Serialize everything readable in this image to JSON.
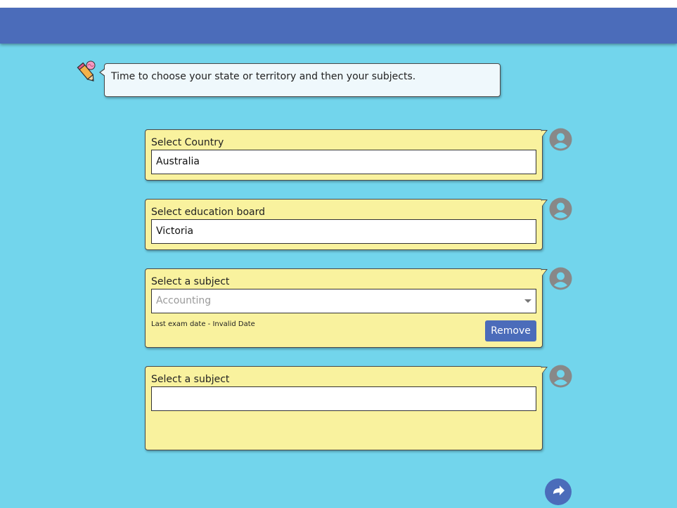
{
  "bot": {
    "avatar_icon": "pencil-brain-icon",
    "message": "Time to choose your state or territory and then your subjects."
  },
  "form": {
    "country": {
      "label": "Select Country",
      "value": "Australia"
    },
    "board": {
      "label": "Select education board",
      "value": "Victoria"
    },
    "subject1": {
      "label": "Select a subject",
      "placeholder": "Accounting",
      "exam_note": "Last exam date - Invalid Date",
      "remove_label": "Remove"
    },
    "subject2": {
      "label": "Select a subject",
      "value": ""
    }
  },
  "colors": {
    "background": "#72d5ec",
    "header": "#4b6cba",
    "card": "#f9f29e",
    "bot_bubble": "#eff8fc",
    "user_avatar": "#888888"
  },
  "icons": {
    "user_avatar": "user-avatar-icon",
    "next": "arrow-next-icon"
  }
}
